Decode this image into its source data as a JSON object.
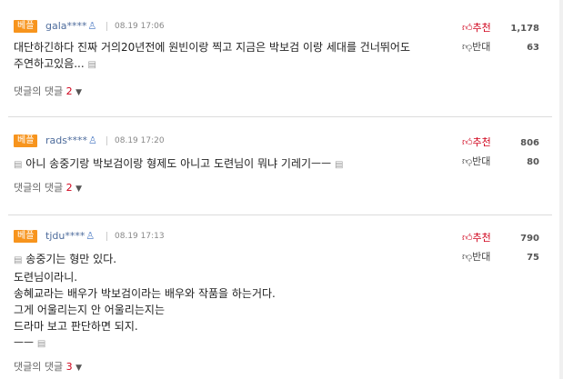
{
  "labels": {
    "best_badge": "베플",
    "upvote": "추천",
    "downvote": "반대",
    "replies_label": "댓글의 댓글"
  },
  "comments": [
    {
      "user": "gala****",
      "timestamp": "08.19 17:06",
      "lines": [
        "대단하긴하다 진짜 거의20년전에 원빈이랑 찍고 지금은 박보검 이랑 세대를 건너뛰어도",
        "주연하고있음..."
      ],
      "upvotes": "1,178",
      "downvotes": "63",
      "reply_count": "2"
    },
    {
      "user": "rads****",
      "timestamp": "08.19 17:20",
      "lines": [
        "아니 송중기랑 박보검이랑 형제도 아니고 도련님이 뭐냐 기레기ㅡㅡ"
      ],
      "upvotes": "806",
      "downvotes": "80",
      "reply_count": "2"
    },
    {
      "user": "tjdu****",
      "timestamp": "08.19 17:13",
      "lines": [
        "송중기는 형만 있다.",
        "도련님이라니.",
        "송혜교라는 배우가 박보검이라는 배우와 작품을 하는거다.",
        "그게 어울리는지 안 어울리는지는",
        "드라마 보고 판단하면 되지.",
        "ㅡㅡ"
      ],
      "upvotes": "790",
      "downvotes": "75",
      "reply_count": "3"
    }
  ],
  "icons": {
    "user": "person-icon",
    "thumbs_up": "thumbs-up-icon",
    "thumbs_down": "thumbs-down-icon",
    "attach": "image-attach-icon",
    "chevron": "chevron-down-icon"
  },
  "colors": {
    "badge": "#f7941d",
    "upvote": "#d0021b",
    "user_id": "#4e6c9c",
    "reply_count": "#d0021b"
  }
}
